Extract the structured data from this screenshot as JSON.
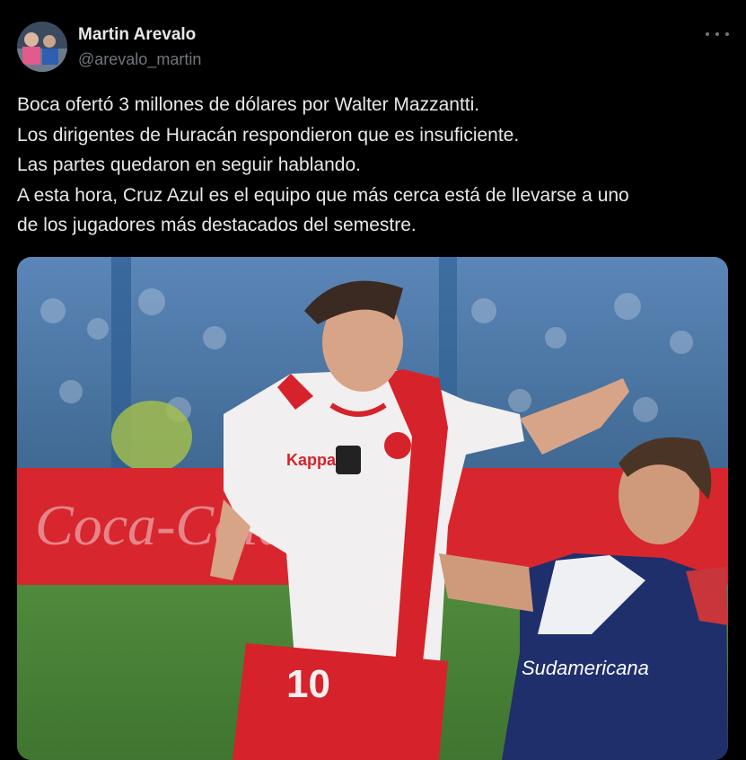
{
  "author": {
    "display_name": "Martin Arevalo",
    "handle": "@arevalo_martin"
  },
  "tweet": {
    "lines": [
      "Boca ofertó 3 millones de dólares por Walter Mazzantti.",
      "Los dirigentes de Huracán respondieron que es insuficiente.",
      "Las partes quedaron en seguir hablando.",
      "A esta hora, Cruz Azul es el equipo que más cerca está de llevarse a uno",
      "de los jugadores más destacados del semestre."
    ]
  },
  "media": {
    "player1_number": "10",
    "shirt_sponsor": "Kappa",
    "player2_sponsor": "Sudamericana",
    "ad_board_text": "Coca-Cola"
  },
  "icons": {
    "more": "more-options-icon"
  },
  "colors": {
    "background": "#000000",
    "text": "#e7e9ea",
    "secondary_text": "#71767b"
  }
}
